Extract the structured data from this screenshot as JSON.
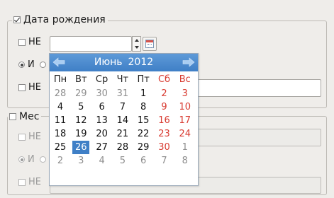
{
  "birthdate_group": {
    "title": "Дата рождения",
    "checked": true,
    "not_label": "НЕ",
    "and_label": "И",
    "not2_label": "НЕ"
  },
  "place_group": {
    "title": "Мес",
    "checked": false,
    "not_label": "НЕ",
    "and_label": "И",
    "not2_label": "НЕ"
  },
  "calendar": {
    "month": "Июнь",
    "year": "2012",
    "weekdays": [
      "Пн",
      "Вт",
      "Ср",
      "Чт",
      "Пт",
      "Сб",
      "Вс"
    ],
    "weeks": [
      [
        "28",
        "29",
        "30",
        "31",
        "1",
        "2",
        "3"
      ],
      [
        "4",
        "5",
        "6",
        "7",
        "8",
        "9",
        "10"
      ],
      [
        "11",
        "12",
        "13",
        "14",
        "15",
        "16",
        "17"
      ],
      [
        "18",
        "19",
        "20",
        "21",
        "22",
        "23",
        "24"
      ],
      [
        "25",
        "26",
        "27",
        "28",
        "29",
        "30",
        "1"
      ],
      [
        "2",
        "3",
        "4",
        "5",
        "6",
        "7",
        "8"
      ]
    ],
    "selected": "26",
    "colors": {
      "header": "#3f7fc6",
      "weekend": "#d83a30",
      "selected": "#3f7fc6",
      "other_month": "#8e8e8e"
    }
  },
  "icons": {
    "prev": "arrow-left-icon",
    "next": "arrow-right-icon",
    "calendar": "calendar-icon"
  }
}
